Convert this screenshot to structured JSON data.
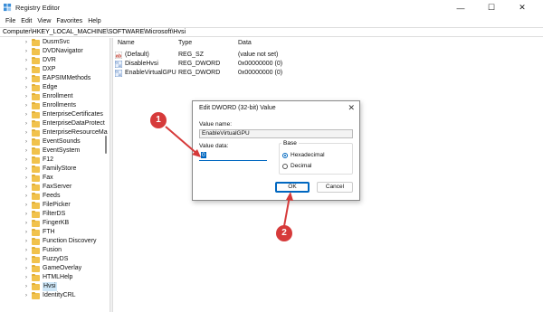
{
  "window": {
    "title": "Registry Editor",
    "minimize_glyph": "—",
    "maximize_glyph": "☐",
    "close_glyph": "✕",
    "app_icon": "registry-icon"
  },
  "menu": [
    "File",
    "Edit",
    "View",
    "Favorites",
    "Help"
  ],
  "address": "Computer\\HKEY_LOCAL_MACHINE\\SOFTWARE\\Microsoft\\Hvsi",
  "tree": {
    "items": [
      {
        "label": "DusmSvc"
      },
      {
        "label": "DVDNavigator"
      },
      {
        "label": "DVR"
      },
      {
        "label": "DXP"
      },
      {
        "label": "EAPSIMMethods"
      },
      {
        "label": "Edge"
      },
      {
        "label": "Enrollment"
      },
      {
        "label": "Enrollments"
      },
      {
        "label": "EnterpriseCertificates"
      },
      {
        "label": "EnterpriseDataProtect"
      },
      {
        "label": "EnterpriseResourceMa"
      },
      {
        "label": "EventSounds"
      },
      {
        "label": "EventSystem"
      },
      {
        "label": "F12"
      },
      {
        "label": "FamilyStore"
      },
      {
        "label": "Fax"
      },
      {
        "label": "FaxServer"
      },
      {
        "label": "Feeds"
      },
      {
        "label": "FilePicker"
      },
      {
        "label": "FilterDS"
      },
      {
        "label": "FingerKB"
      },
      {
        "label": "FTH"
      },
      {
        "label": "Function Discovery"
      },
      {
        "label": "Fusion"
      },
      {
        "label": "FuzzyDS"
      },
      {
        "label": "GameOverlay"
      },
      {
        "label": "HTMLHelp"
      },
      {
        "label": "Hvsi",
        "selected": true
      },
      {
        "label": "IdentityCRL"
      }
    ],
    "chevron_glyph": "›",
    "folder_color": "#f1c24c",
    "selected_color": "#cde6f7"
  },
  "list": {
    "headers": [
      "Name",
      "Type",
      "Data"
    ],
    "rows": [
      {
        "name": "(Default)",
        "type": "REG_SZ",
        "data": "(value not set)",
        "icon": "string-value-icon"
      },
      {
        "name": "DisableHvsi",
        "type": "REG_DWORD",
        "data": "0x00000000 (0)",
        "icon": "binary-value-icon"
      },
      {
        "name": "EnableVirtualGPU",
        "type": "REG_DWORD",
        "data": "0x00000000 (0)",
        "icon": "binary-value-icon"
      }
    ]
  },
  "dialog": {
    "title": "Edit DWORD (32-bit) Value",
    "close_glyph": "✕",
    "value_name_label": "Value name:",
    "value_name": "EnableVirtualGPU",
    "value_data_label": "Value data:",
    "value_data": "0",
    "base_label": "Base",
    "base_options": [
      {
        "label": "Hexadecimal",
        "selected": true
      },
      {
        "label": "Decimal",
        "selected": false
      }
    ],
    "ok_label": "OK",
    "cancel_label": "Cancel",
    "accent": "#0067c0"
  },
  "callouts": [
    {
      "number": "1",
      "color": "#d63a3a"
    },
    {
      "number": "2",
      "color": "#d63a3a"
    }
  ]
}
